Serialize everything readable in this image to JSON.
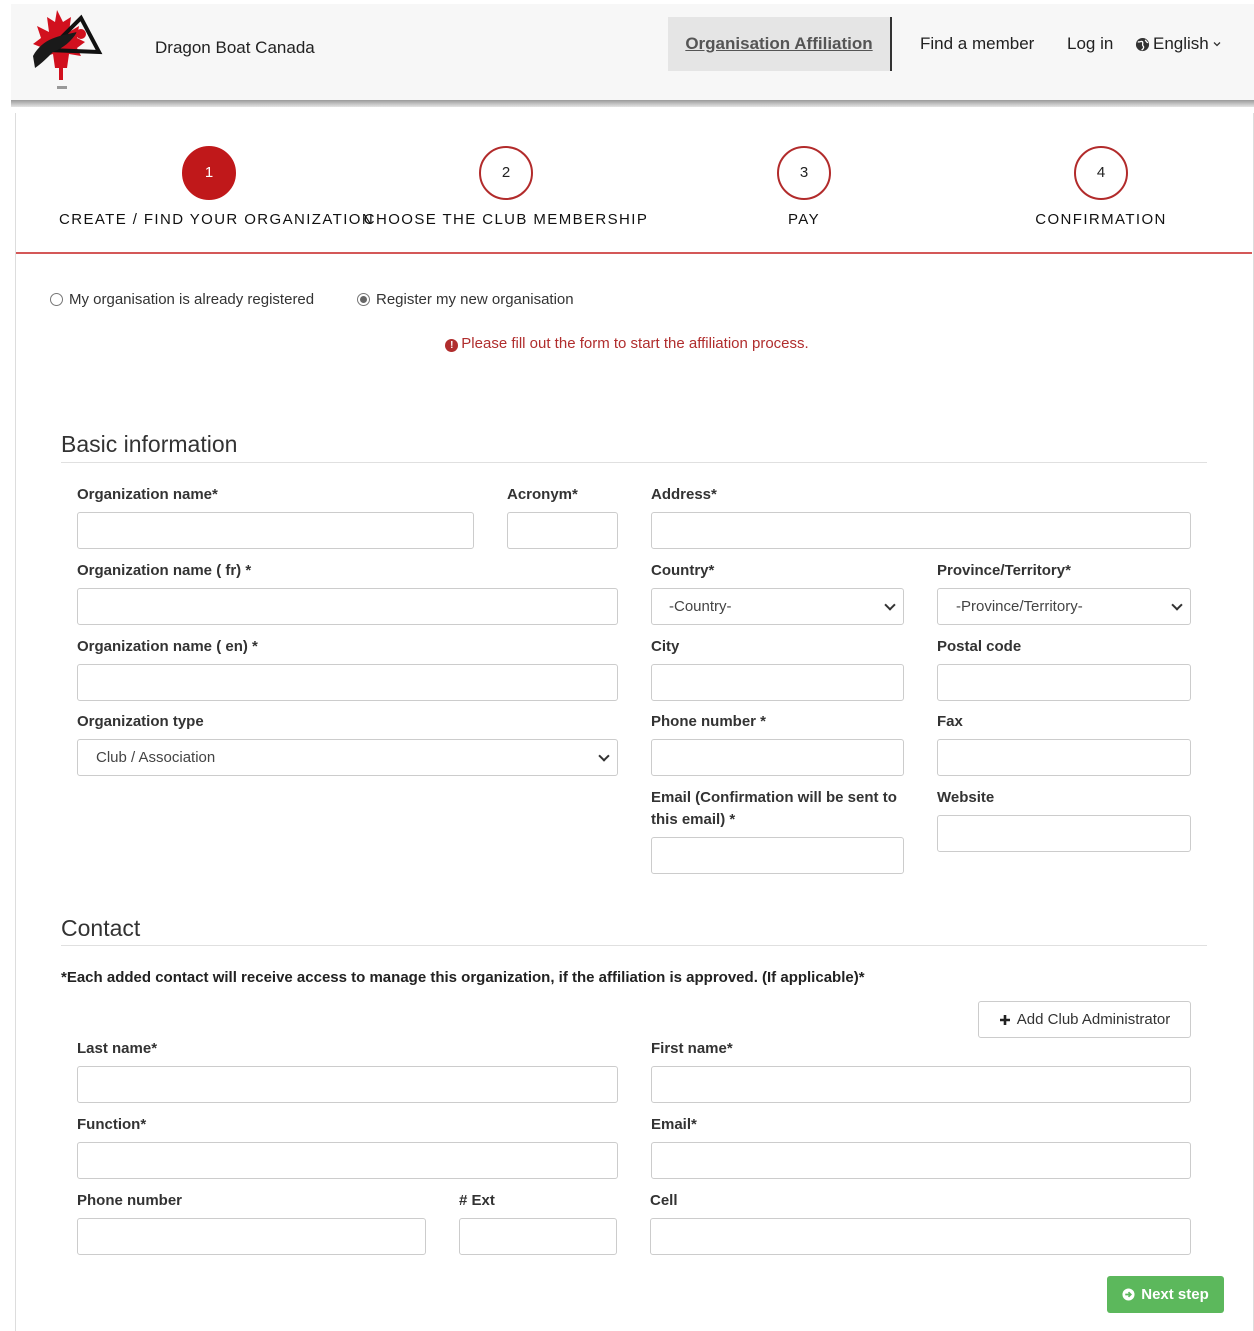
{
  "header": {
    "brand": "Dragon Boat Canada",
    "nav": {
      "affiliation": "Organisation Affiliation",
      "find_member": "Find a member",
      "login": "Log in",
      "language": "English"
    }
  },
  "steps": [
    {
      "number": "1",
      "label": "CREATE / FIND YOUR ORGANIZATION"
    },
    {
      "number": "2",
      "label": "CHOOSE THE CLUB MEMBERSHIP"
    },
    {
      "number": "3",
      "label": "PAY"
    },
    {
      "number": "4",
      "label": "CONFIRMATION"
    }
  ],
  "registration_options": {
    "existing": "My organisation is already registered",
    "new": "Register my new organisation",
    "selected": "new"
  },
  "alert": "Please fill out the form to start the affiliation process.",
  "basic": {
    "title": "Basic information",
    "org_name": "Organization name*",
    "acronym": "Acronym*",
    "address": "Address*",
    "org_name_fr": "Organization name ( fr) *",
    "country": "Country*",
    "country_value": "-Country-",
    "province": "Province/Territory*",
    "province_value": "-Province/Territory-",
    "org_name_en": "Organization name ( en) *",
    "city": "City",
    "postal_code": "Postal code",
    "org_type": "Organization type",
    "org_type_value": "Club / Association",
    "phone": "Phone number *",
    "fax": "Fax",
    "email": "Email (Confirmation will be sent to this email) *",
    "website": "Website"
  },
  "contact": {
    "title": "Contact",
    "note": "*Each added contact will receive access to manage this organization, if the affiliation is approved. (If applicable)*",
    "add_button": "Add Club Administrator",
    "last_name": "Last name*",
    "first_name": "First name*",
    "function": "Function*",
    "email": "Email*",
    "phone": "Phone number",
    "ext": "# Ext",
    "cell": "Cell"
  },
  "next_button": "Next step",
  "colors": {
    "brand_red": "#c0181a",
    "alert_red": "#b02d2d",
    "success_green": "#5cb85c"
  }
}
